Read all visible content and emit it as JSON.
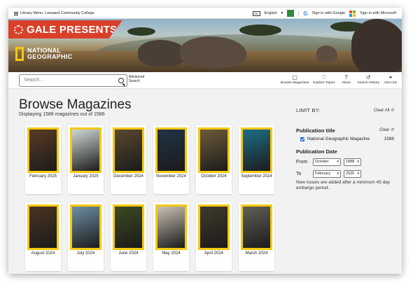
{
  "topbar": {
    "library": "Library Menu: Leeward Community College",
    "language": "English",
    "google_signin": "Sign in with Google",
    "microsoft_signin": "Sign in with Microsoft"
  },
  "banner": {
    "presents": "GALE PRESENTS",
    "brand_line1": "NATIONAL",
    "brand_line2": "GEOGRAPHIC"
  },
  "search": {
    "placeholder": "Search...",
    "advanced_line1": "Advanced",
    "advanced_line2": "Search"
  },
  "tools": [
    {
      "label": "Browse Magazines",
      "icon": "book-icon"
    },
    {
      "label": "Explore Topics",
      "icon": "lightbulb-icon"
    },
    {
      "label": "About",
      "icon": "question-icon"
    },
    {
      "label": "Search History",
      "icon": "history-icon"
    },
    {
      "label": "Get Link",
      "icon": "link-icon"
    }
  ],
  "main": {
    "title": "Browse Magazines",
    "subtitle": "Displaying 1586 magazines out of 1586"
  },
  "magazines": [
    {
      "label": "February 2025",
      "color": "#5a3b25"
    },
    {
      "label": "January 2025",
      "color": "#cfd8d6"
    },
    {
      "label": "December 2024",
      "color": "#5a4830"
    },
    {
      "label": "November 2024",
      "color": "#1f3447"
    },
    {
      "label": "October 2024",
      "color": "#6d5a3a"
    },
    {
      "label": "September 2024",
      "color": "#1d6f88"
    },
    {
      "label": "August 2024",
      "color": "#4a3423"
    },
    {
      "label": "July 2024",
      "color": "#6e8fa3"
    },
    {
      "label": "June 2024",
      "color": "#3d4a22"
    },
    {
      "label": "May 2024",
      "color": "#c9c1b3"
    },
    {
      "label": "April 2024",
      "color": "#3f3a2b"
    },
    {
      "label": "March 2024",
      "color": "#5f6157"
    }
  ],
  "sidebar": {
    "limit_by": "LIMIT BY:",
    "clear_all": "Clear All",
    "pub_title_heading": "Publication title",
    "clear": "Clear",
    "pub_title_item": "National Geographic Magazine",
    "pub_title_count": "1586",
    "pub_date_heading": "Publication Date",
    "from_label": "From",
    "from_month": "October",
    "from_year": "1888",
    "to_label": "To",
    "to_month": "February",
    "to_year": "2025",
    "note": "New issues are added after a minimum 45 day embargo period."
  },
  "colors": {
    "brand_red": "#d9402a",
    "natgeo_yellow": "#f6c90e",
    "checkbox_blue": "#1a6fd1"
  }
}
